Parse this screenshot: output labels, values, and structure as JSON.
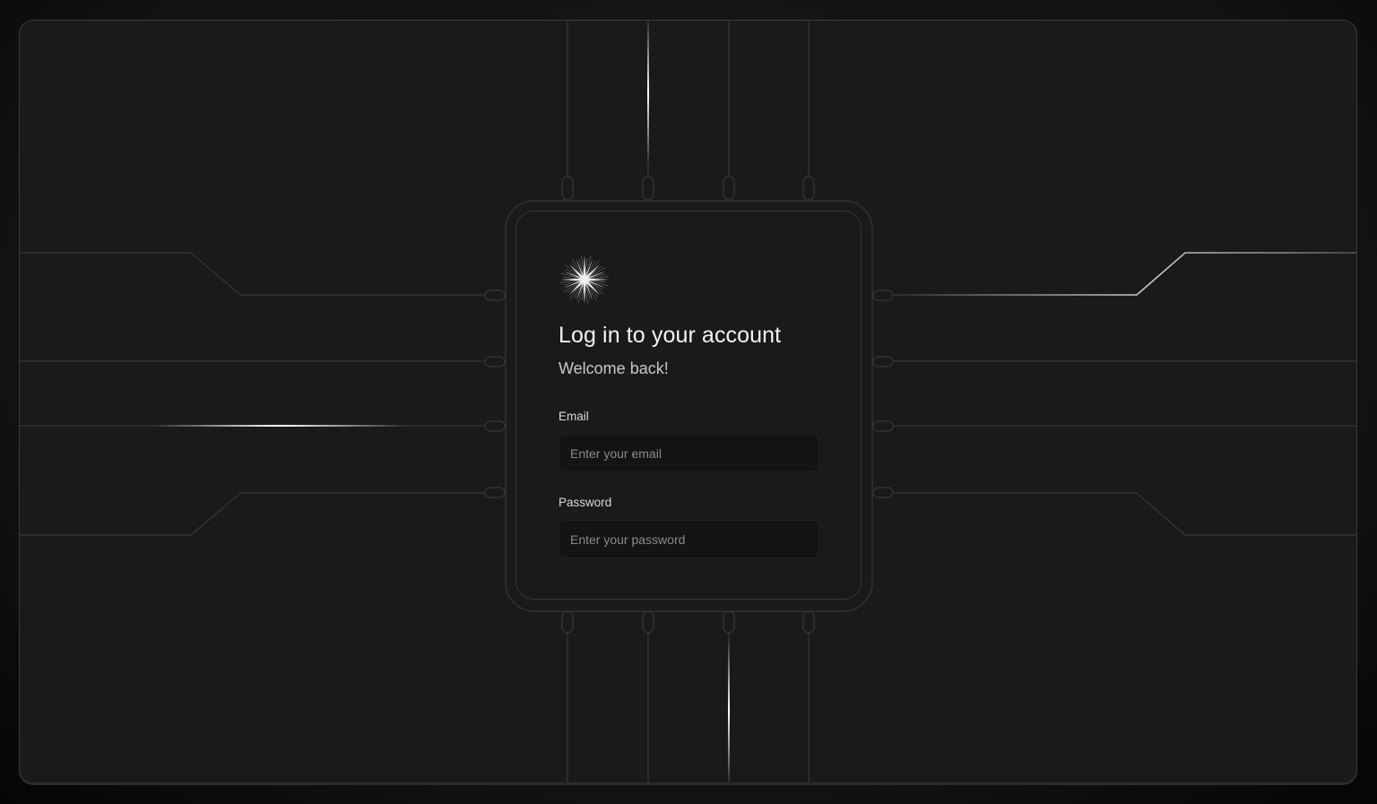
{
  "login": {
    "logo_icon": "starburst-icon",
    "title": "Log in to your account",
    "subtitle": "Welcome back!",
    "email": {
      "label": "Email",
      "placeholder": "Enter your email",
      "value": ""
    },
    "password": {
      "label": "Password",
      "placeholder": "Enter your password",
      "value": ""
    }
  },
  "theme": {
    "background": "#1a1a19",
    "line": "#333332",
    "glow": "#ffffff",
    "text_primary": "#f4f4f4",
    "text_secondary": "#c8c8c8",
    "input_bg": "#141414"
  }
}
